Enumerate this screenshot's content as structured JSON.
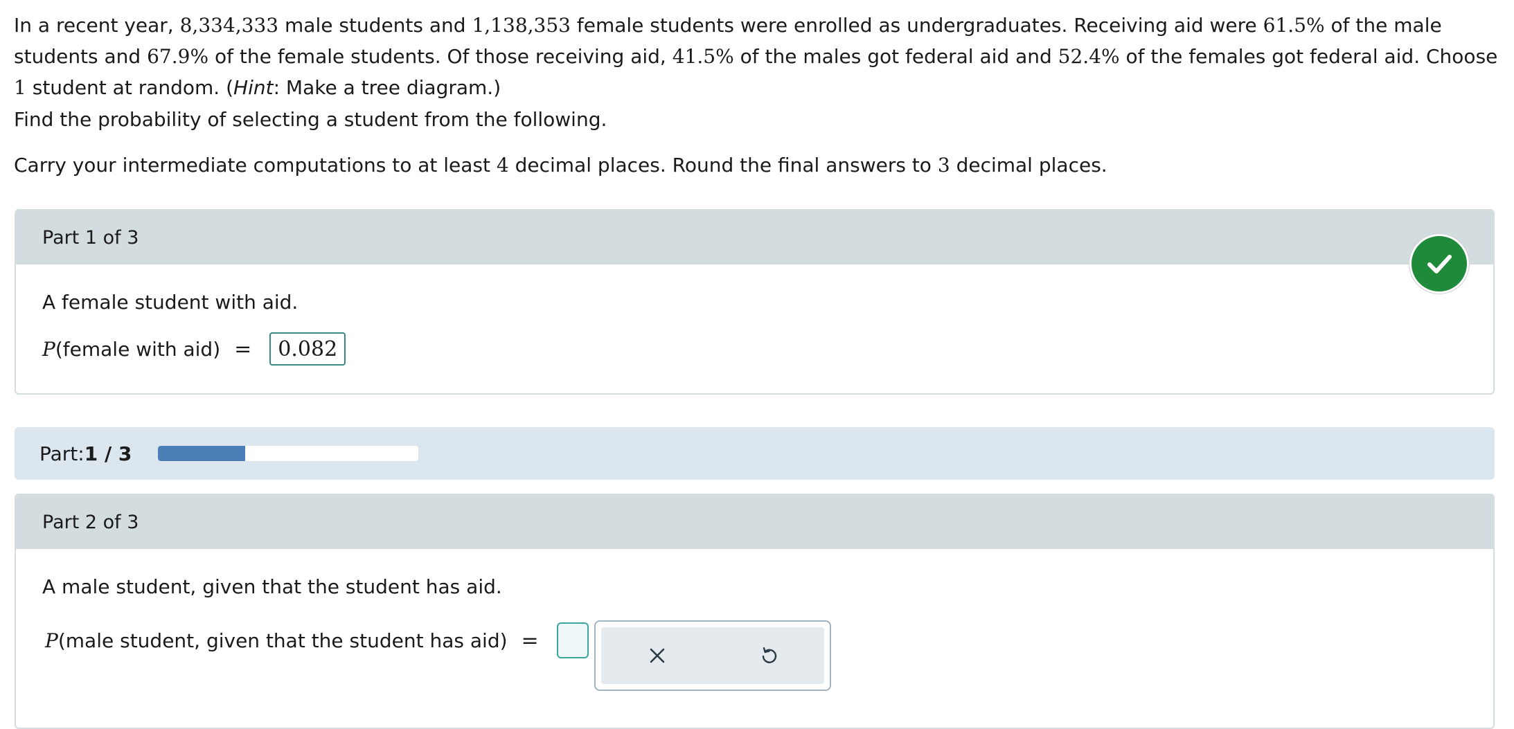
{
  "problem": {
    "s1": "In a recent year, ",
    "male_count": "8,334,333",
    "s2": " male students and ",
    "female_count": "1,138,353",
    "s3": " female students were enrolled as undergraduates. Receiving aid were ",
    "male_aid_pct": "61.5%",
    "s4": " of the male students and ",
    "female_aid_pct": "67.9%",
    "s5": " of the female students. Of those receiving aid, ",
    "male_fed_pct": "41.5%",
    "s6": " of the males got federal aid and ",
    "female_fed_pct": "52.4%",
    "s7": " of the females got federal aid. Choose ",
    "choose_n": "1",
    "s8": " student at random. (",
    "hint_word": "Hint",
    "s9": ": Make a tree diagram.)"
  },
  "instructions": {
    "find": "Find the probability of selecting a student from the following.",
    "carry_a": "Carry your intermediate computations to at least ",
    "carry_n": "4",
    "carry_b": " decimal places. Round the final answers to ",
    "round_n": "3",
    "carry_c": " decimal places."
  },
  "part1": {
    "header": "Part 1 of 3",
    "question": "A female student with aid.",
    "p_symbol": "P",
    "p_arg": "(female with aid)",
    "eq": "=",
    "answer": "0.082",
    "status_color": "#1f8a3a",
    "status_icon": "check-icon"
  },
  "progress": {
    "label": "Part: ",
    "value": "1 / 3",
    "fraction": 0.333,
    "fill_color": "#4a7fb8"
  },
  "part2": {
    "header": "Part 2 of 3",
    "question": "A male student, given that the student has aid.",
    "p_symbol": "P",
    "p_arg": "(male student, given that the student has aid)",
    "eq": "=",
    "answer": "",
    "tools": [
      "clear-icon",
      "undo-icon"
    ]
  }
}
